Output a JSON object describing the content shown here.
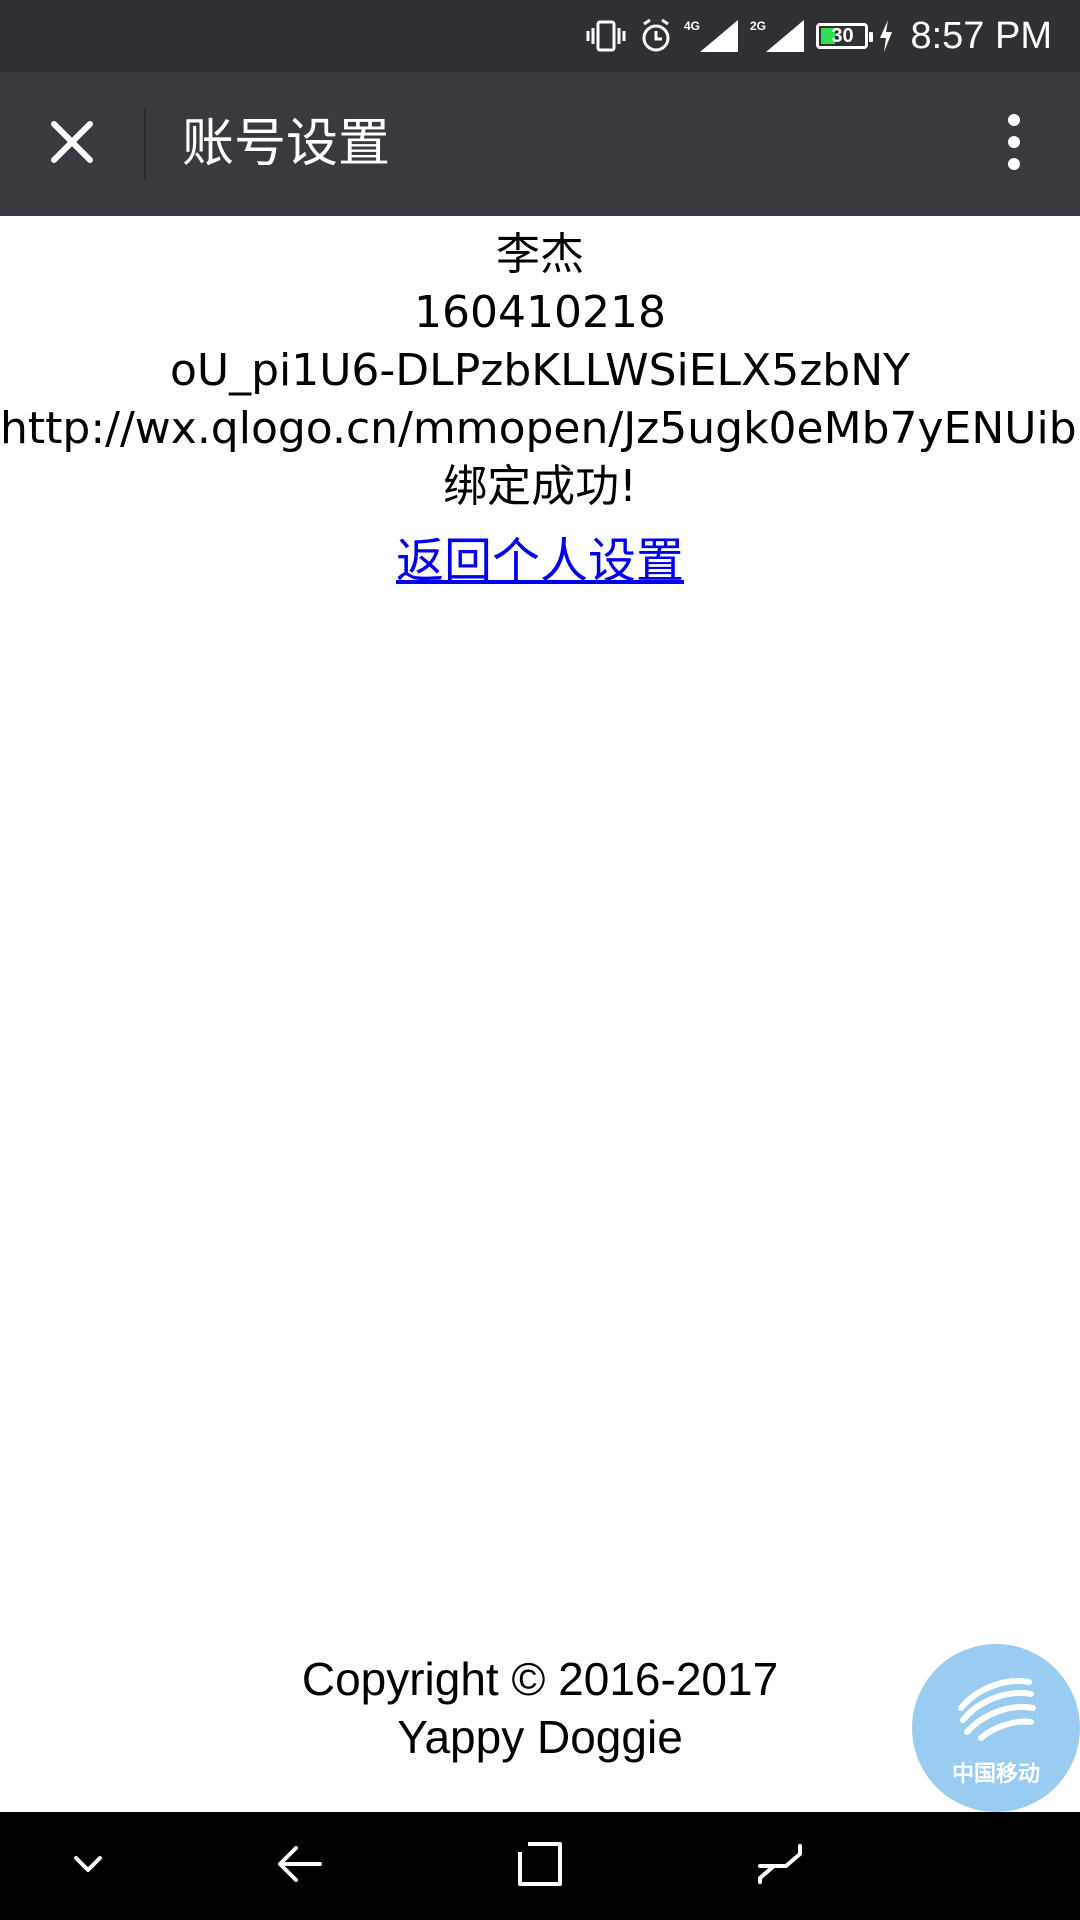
{
  "status_bar": {
    "time": "8:57 PM",
    "battery_level": "30",
    "network_1": "4G",
    "network_2": "2G",
    "icons": [
      "vibrate-icon",
      "alarm-icon",
      "signal-4g-icon",
      "signal-2g-icon",
      "battery-icon",
      "charging-icon"
    ]
  },
  "app_bar": {
    "title": "账号设置",
    "close_icon": "close-icon",
    "menu_icon": "more-vertical-icon"
  },
  "content": {
    "name": "李杰",
    "student_id": "160410218",
    "openid": "oU_pi1U6-DLPzbKLLWSiELX5zbNY",
    "avatar_url": "http://wx.qlogo.cn/mmopen/Jz5ugk0eMb7yENUib",
    "status_message": "绑定成功!",
    "back_link": "返回个人设置"
  },
  "footer": {
    "copyright": "Copyright © 2016-2017",
    "company": "Yappy Doggie"
  },
  "floating_badge": {
    "label": "中国移动"
  },
  "nav_bar": {
    "icons": [
      "chevron-down-icon",
      "back-icon",
      "recent-apps-icon",
      "home-icon"
    ]
  },
  "colors": {
    "status_bar_bg": "#2f3033",
    "app_bar_bg": "#393a3f",
    "link": "#0000ee",
    "nav_bar_bg": "#000000",
    "badge_bg": "#78b9eb",
    "battery_fill": "#2ee04f"
  }
}
